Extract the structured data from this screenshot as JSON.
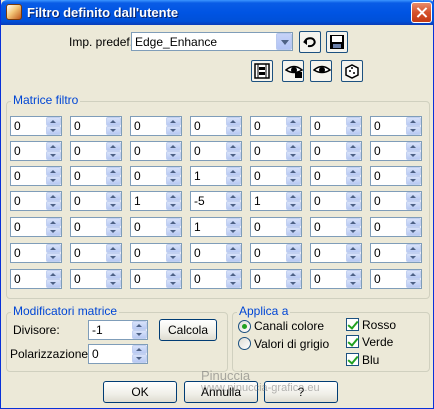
{
  "window": {
    "title": "Filtro definito dall'utente"
  },
  "preset": {
    "label": "Imp. predef.:",
    "value": "Edge_Enhance"
  },
  "matrix": {
    "title": "Matrice filtro",
    "rows": [
      [
        "0",
        "0",
        "0",
        "0",
        "0",
        "0",
        "0"
      ],
      [
        "0",
        "0",
        "0",
        "0",
        "0",
        "0",
        "0"
      ],
      [
        "0",
        "0",
        "0",
        "1",
        "0",
        "0",
        "0"
      ],
      [
        "0",
        "0",
        "1",
        "-5",
        "1",
        "0",
        "0"
      ],
      [
        "0",
        "0",
        "0",
        "1",
        "0",
        "0",
        "0"
      ],
      [
        "0",
        "0",
        "0",
        "0",
        "0",
        "0",
        "0"
      ],
      [
        "0",
        "0",
        "0",
        "0",
        "0",
        "0",
        "0"
      ]
    ]
  },
  "modifiers": {
    "title": "Modificatori matrice",
    "divisor_label": "Divisore:",
    "divisor_value": "-1",
    "calc_label": "Calcola",
    "bias_label": "Polarizzazione:",
    "bias_value": "0"
  },
  "apply": {
    "title": "Applica a",
    "radio_color": "Canali colore",
    "radio_gray": "Valori di grigio",
    "check_red": "Rosso",
    "check_green": "Verde",
    "check_blue": "Blu"
  },
  "buttons": {
    "ok": "OK",
    "cancel": "Annulla",
    "help": "?"
  },
  "watermark": {
    "line1": "Pinuccia",
    "line2": "www.pinuccia-grafica.eu"
  }
}
